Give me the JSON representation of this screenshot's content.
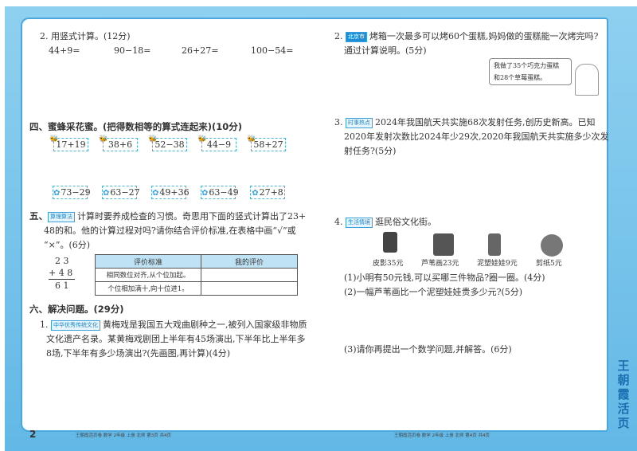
{
  "left": {
    "q2": {
      "title": "2. 用竖式计算。(12分)",
      "items": [
        "44+9=",
        "90−18=",
        "26+27=",
        "100−54="
      ]
    },
    "s4": {
      "title": "四、蜜蜂采花蜜。(把得数相等的算式连起来)(10分)",
      "bees": [
        "17+19",
        "38+6",
        "52−38",
        "44−9",
        "58+27"
      ],
      "flowers": [
        "73−29",
        "63−27",
        "49+36",
        "63−49",
        "27+8"
      ]
    },
    "s5": {
      "num": "五、",
      "tag": "算理算法",
      "lines": [
        "计算时要养成检查的习惯。奇思用下面的竖式计算出了23+",
        "48的和。他的计算过程对吗?请你结合评价标准,在表格中画“√”或",
        "“×”。(6分)"
      ],
      "vertical": [
        "2 3",
        "+ 4 8",
        "6 1"
      ],
      "table": {
        "headers": [
          "评价标准",
          "我的评价"
        ],
        "rows": [
          "相同数位对齐,从个位加起。",
          "个位相加满十,向十位进1。"
        ]
      }
    },
    "s6": {
      "title": "六、解决问题。(29分)",
      "q1": {
        "num": "1.",
        "tag": "中华优秀传统文化",
        "lines": [
          "黄梅戏是我国五大戏曲剧种之一,被列入国家级非物质",
          "文化遗产名录。某黄梅戏剧团上半年有45场演出,下半年比上半年多",
          "8场,下半年有多少场演出?(先画图,再计算)(4分)"
        ]
      }
    },
    "page_num": "2",
    "footer": "王朝霞活页卷  数学  2年级  上册  北师  第3页  共4页"
  },
  "right": {
    "q2": {
      "num": "2.",
      "tag": "北京市",
      "lines": [
        "烤箱一次最多可以烤60个蛋糕,妈妈做的蛋糕能一次烤完吗?",
        "通过计算说明。(5分)"
      ],
      "bubble": [
        "我做了35个巧克力蛋糕",
        "和28个草莓蛋糕。"
      ]
    },
    "q3": {
      "num": "3.",
      "tag": "时事热点",
      "lines": [
        "2024年我国航天共实施68次发射任务,创历史新高。已知",
        "2020年发射次数比2024年少29次,2020年我国航天共实施多少次发",
        "射任务?(5分)"
      ]
    },
    "q4": {
      "num": "4.",
      "tag": "生活情境",
      "title": "逛民俗文化街。",
      "items": [
        "皮影35元",
        "芦苇画23元",
        "泥塑娃娃9元",
        "剪纸5元"
      ],
      "subs": [
        "(1)小明有50元钱,可以买哪三件物品?圈一圈。(4分)",
        "(2)一幅芦苇画比一个泥塑娃娃贵多少元?(5分)",
        "(3)请你再提出一个数学问题,并解答。(6分)"
      ]
    },
    "footer": "王朝霞活页卷  数学  2年级  上册  北师  第4页  共4页",
    "brand": "王朝霞活页"
  }
}
